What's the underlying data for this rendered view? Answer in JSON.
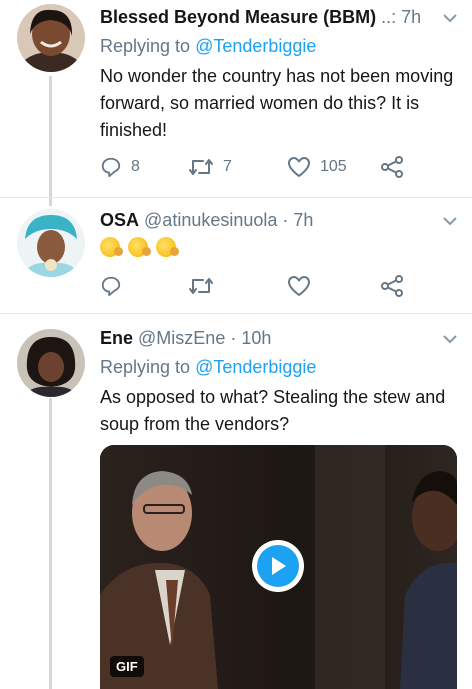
{
  "tweets": [
    {
      "name": "Blessed Beyond Measure (BBM)",
      "handle": "..:",
      "time": "7h",
      "replying_prefix": "Replying to ",
      "replying_to": "@Tenderbiggie",
      "text": "No wonder the country has not been moving forward, so married women do this? It is finished!",
      "reply_count": "8",
      "retweet_count": "7",
      "like_count": "105"
    },
    {
      "name": "OSA",
      "handle": "@atinukesinuola",
      "time": "7h",
      "emoji": [
        "drooling-face-emoji",
        "drooling-face-emoji",
        "drooling-face-emoji"
      ]
    },
    {
      "name": "Ene",
      "handle": "@MiszEne",
      "time": "10h",
      "replying_prefix": "Replying to ",
      "replying_to": "@Tenderbiggie",
      "text": "As opposed to what? Stealing the stew and soup from the vendors?",
      "media_badge": "GIF"
    }
  ],
  "separator": "·",
  "icons": {
    "reply": "reply-icon",
    "retweet": "retweet-icon",
    "like": "heart-icon",
    "share": "share-icon",
    "more": "chevron-down-icon",
    "play": "play-icon"
  },
  "colors": {
    "accent": "#1da1f2",
    "muted": "#657786",
    "text": "#14171a",
    "thread_line": "#cfd9de"
  }
}
